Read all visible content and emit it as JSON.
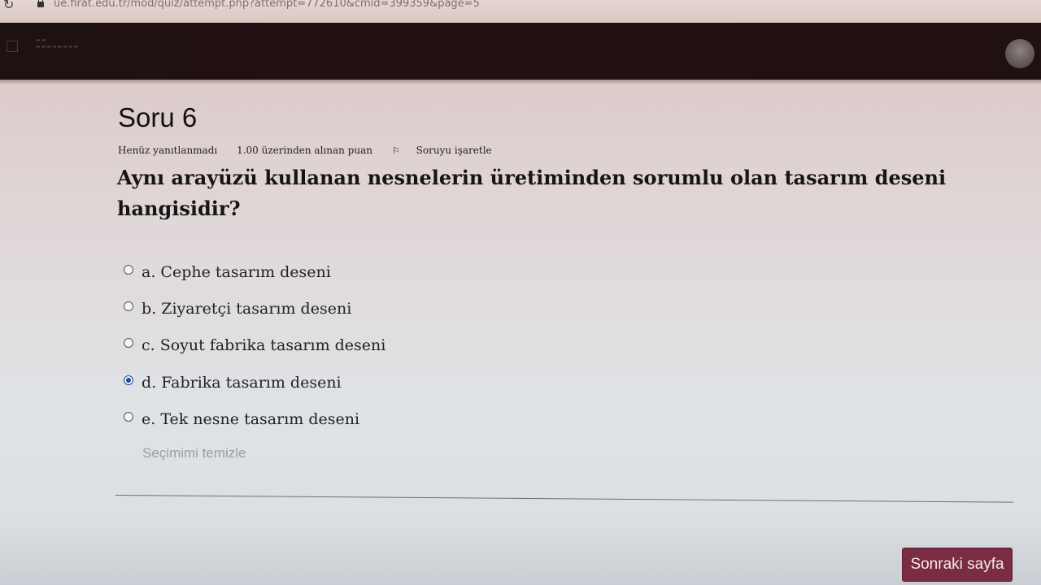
{
  "browser": {
    "url": "ue.firat.edu.tr/mod/quiz/attempt.php?attempt=772610&cmid=399359&page=5"
  },
  "question": {
    "title": "Soru 6",
    "status": "Henüz yanıtlanmadı",
    "grade": "1.00 üzerinden alınan puan",
    "flag_label": "Soruyu işaretle",
    "text": "Aynı arayüzü kullanan nesnelerin üretiminden sorumlu olan tasarım deseni hangisidir?",
    "answers": [
      {
        "label": "a. Cephe tasarım deseni",
        "selected": false
      },
      {
        "label": "b. Ziyaretçi tasarım deseni",
        "selected": false
      },
      {
        "label": "c. Soyut fabrika tasarım deseni",
        "selected": false
      },
      {
        "label": "d. Fabrika tasarım deseni",
        "selected": true
      },
      {
        "label": "e. Tek nesne tasarım deseni",
        "selected": false
      }
    ],
    "clear_label": "Seçimimi temizle"
  },
  "navigation": {
    "next_label": "Sonraki sayfa"
  },
  "colors": {
    "header_bg": "#241013",
    "button_bg": "#7a2c42",
    "radio_selected": "#1a4c9c"
  }
}
